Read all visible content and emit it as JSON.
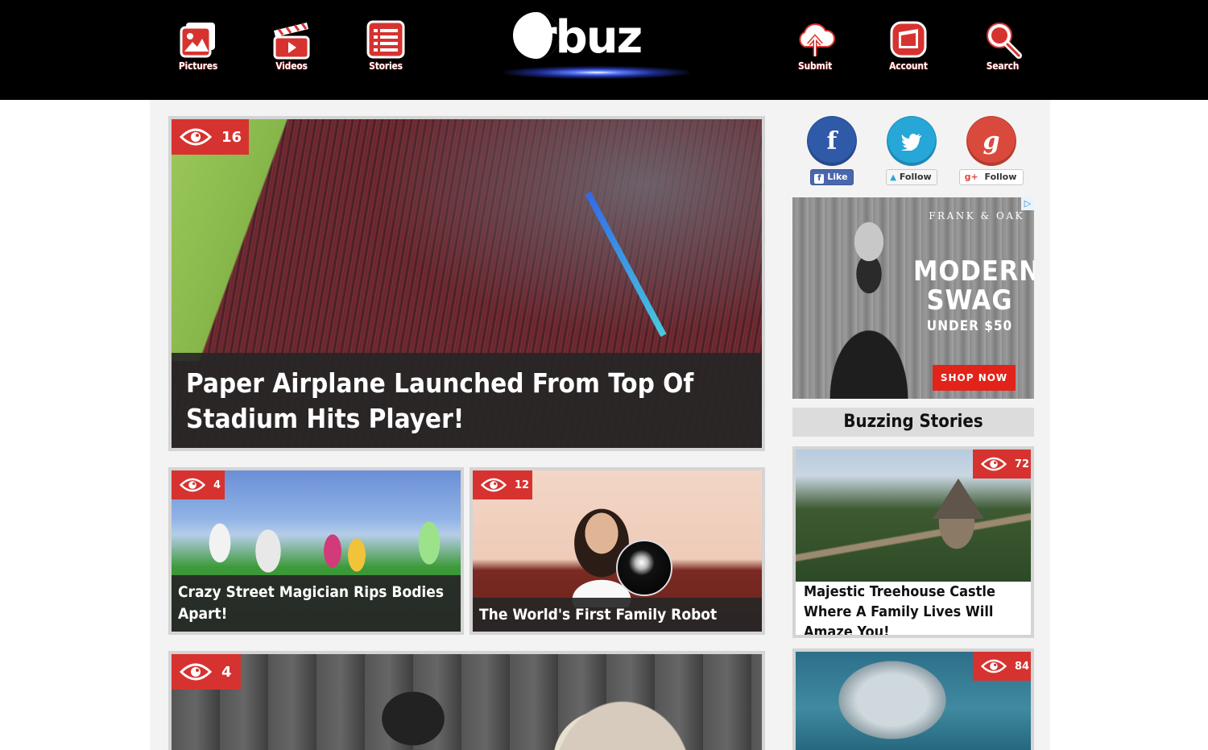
{
  "nav": {
    "left": [
      {
        "label": "Pictures",
        "icon": "pictures-icon"
      },
      {
        "label": "Videos",
        "icon": "videos-icon"
      },
      {
        "label": "Stories",
        "icon": "stories-icon"
      }
    ],
    "right": [
      {
        "label": "Submit",
        "icon": "submit-icon"
      },
      {
        "label": "Account",
        "icon": "account-icon"
      },
      {
        "label": "Search",
        "icon": "search-icon"
      }
    ]
  },
  "logo": {
    "text": "rbuz"
  },
  "hero": {
    "views": "16",
    "title": "Paper Airplane Launched From Top Of Stadium Hits Player!"
  },
  "cards": [
    {
      "views": "4",
      "title": "Crazy Street Magician Rips Bodies Apart!"
    },
    {
      "views": "12",
      "title": "The World's First Family Robot"
    },
    {
      "views": "4",
      "title": ""
    }
  ],
  "social": {
    "facebook": {
      "button": "Like"
    },
    "twitter": {
      "button": "Follow"
    },
    "google": {
      "button": "Follow"
    }
  },
  "ad": {
    "brand": "FRANK & OAK",
    "headline": "MODERN SWAG",
    "subline": "UNDER $50",
    "cta": "SHOP NOW"
  },
  "sidebar": {
    "heading": "Buzzing Stories",
    "stories": [
      {
        "views": "72",
        "title": "Majestic Treehouse Castle Where A Family Lives Will Amaze You!"
      },
      {
        "views": "84",
        "title": ""
      }
    ]
  },
  "colors": {
    "accent_red": "#d63330",
    "header_bg": "#000000",
    "content_bg": "#f3f3f3"
  }
}
